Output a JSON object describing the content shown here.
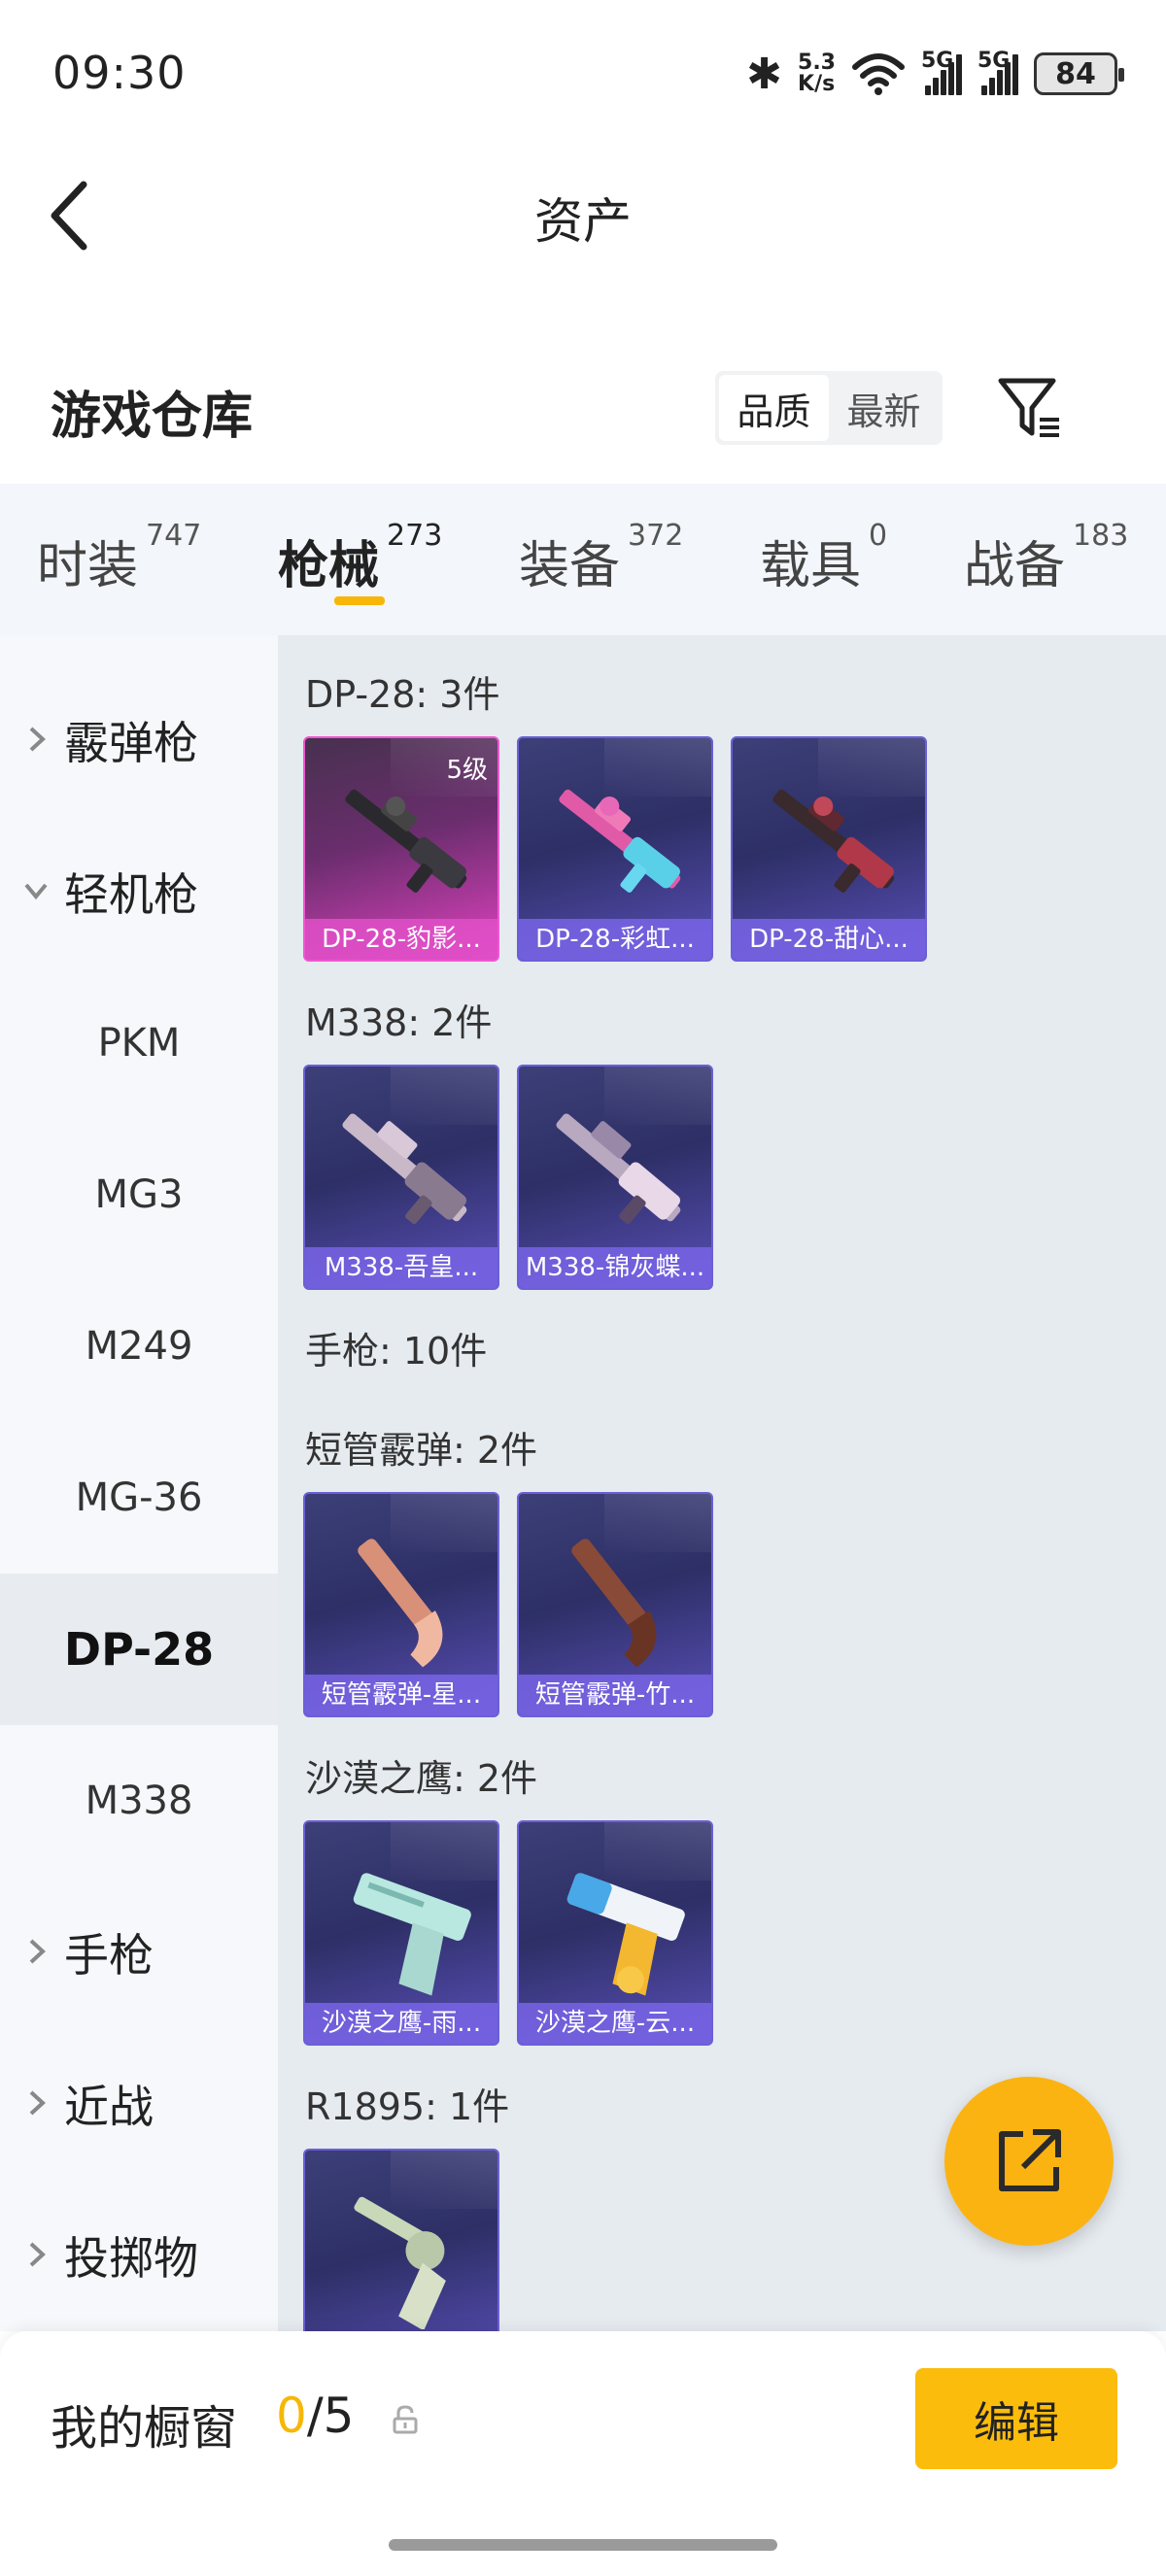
{
  "status_bar": {
    "time": "09:30",
    "speed_value": "5.3",
    "speed_unit": "K/s",
    "net1": "5G",
    "net2": "5G",
    "battery": "84"
  },
  "header": {
    "title": "资产"
  },
  "warehouse": {
    "title": "游戏仓库",
    "sort_options": [
      "品质",
      "最新"
    ]
  },
  "tabs": [
    {
      "label": "时装",
      "count": "747"
    },
    {
      "label": "枪械",
      "count": "273"
    },
    {
      "label": "装备",
      "count": "372"
    },
    {
      "label": "载具",
      "count": "0"
    },
    {
      "label": "战备",
      "count": "183"
    }
  ],
  "sidebar": {
    "groups": [
      "霰弹枪",
      "轻机枪",
      "手枪",
      "近战",
      "投掷物"
    ],
    "subs": [
      "PKM",
      "MG3",
      "M249",
      "MG-36",
      "DP-28",
      "M338"
    ],
    "active_sub": "DP-28"
  },
  "sections": [
    {
      "title": "DP-28: 3件",
      "items": [
        {
          "label": "DP-28-豹影...",
          "level": "5级"
        },
        {
          "label": "DP-28-彩虹..."
        },
        {
          "label": "DP-28-甜心..."
        }
      ]
    },
    {
      "title": "M338: 2件",
      "items": [
        {
          "label": "M338-吾皇..."
        },
        {
          "label": "M338-锦灰蝶..."
        }
      ]
    },
    {
      "title": "手枪: 10件"
    },
    {
      "title": "短管霰弹: 2件",
      "items": [
        {
          "label": "短管霰弹-星..."
        },
        {
          "label": "短管霰弹-竹..."
        }
      ]
    },
    {
      "title": "沙漠之鹰: 2件",
      "items": [
        {
          "label": "沙漠之鹰-雨..."
        },
        {
          "label": "沙漠之鹰-云..."
        }
      ]
    },
    {
      "title": "R1895: 1件"
    }
  ],
  "bottom": {
    "label": "我的橱窗",
    "current": "0",
    "total": "/5",
    "edit_label": "编辑"
  },
  "colors": {
    "accent": "#f6b708",
    "card_epic": "#2d2f66",
    "card_legend": "#e042c0"
  }
}
